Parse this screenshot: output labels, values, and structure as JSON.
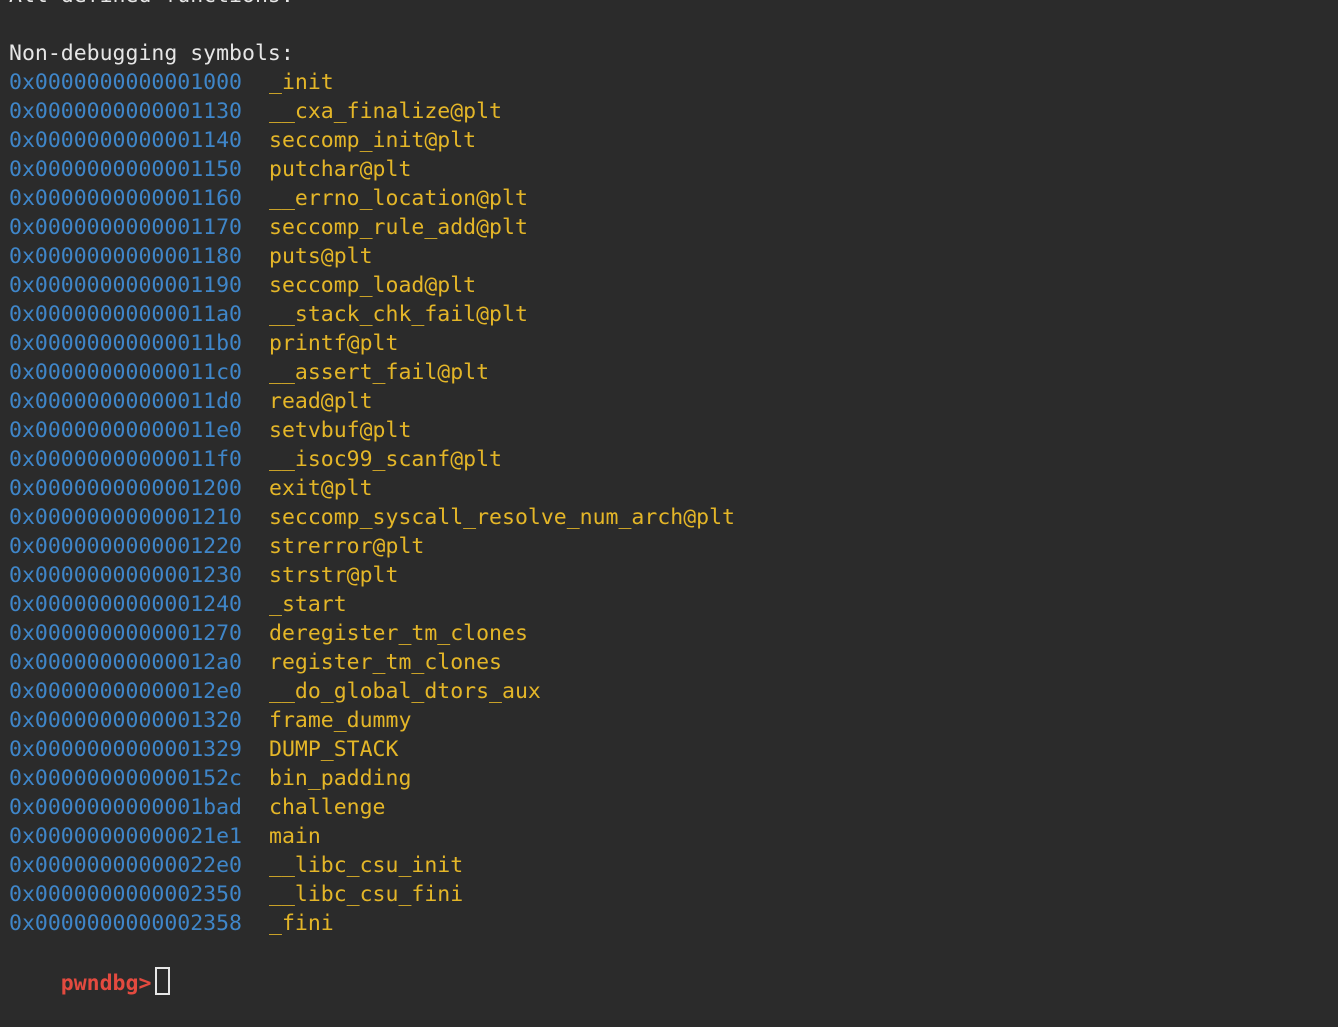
{
  "header": {
    "partial_line": "All defined functions:",
    "section_title": "Non-debugging symbols:"
  },
  "symbols": [
    {
      "addr": "0x0000000000001000",
      "name": "_init"
    },
    {
      "addr": "0x0000000000001130",
      "name": "__cxa_finalize@plt"
    },
    {
      "addr": "0x0000000000001140",
      "name": "seccomp_init@plt"
    },
    {
      "addr": "0x0000000000001150",
      "name": "putchar@plt"
    },
    {
      "addr": "0x0000000000001160",
      "name": "__errno_location@plt"
    },
    {
      "addr": "0x0000000000001170",
      "name": "seccomp_rule_add@plt"
    },
    {
      "addr": "0x0000000000001180",
      "name": "puts@plt"
    },
    {
      "addr": "0x0000000000001190",
      "name": "seccomp_load@plt"
    },
    {
      "addr": "0x00000000000011a0",
      "name": "__stack_chk_fail@plt"
    },
    {
      "addr": "0x00000000000011b0",
      "name": "printf@plt"
    },
    {
      "addr": "0x00000000000011c0",
      "name": "__assert_fail@plt"
    },
    {
      "addr": "0x00000000000011d0",
      "name": "read@plt"
    },
    {
      "addr": "0x00000000000011e0",
      "name": "setvbuf@plt"
    },
    {
      "addr": "0x00000000000011f0",
      "name": "__isoc99_scanf@plt"
    },
    {
      "addr": "0x0000000000001200",
      "name": "exit@plt"
    },
    {
      "addr": "0x0000000000001210",
      "name": "seccomp_syscall_resolve_num_arch@plt"
    },
    {
      "addr": "0x0000000000001220",
      "name": "strerror@plt"
    },
    {
      "addr": "0x0000000000001230",
      "name": "strstr@plt"
    },
    {
      "addr": "0x0000000000001240",
      "name": "_start"
    },
    {
      "addr": "0x0000000000001270",
      "name": "deregister_tm_clones"
    },
    {
      "addr": "0x00000000000012a0",
      "name": "register_tm_clones"
    },
    {
      "addr": "0x00000000000012e0",
      "name": "__do_global_dtors_aux"
    },
    {
      "addr": "0x0000000000001320",
      "name": "frame_dummy"
    },
    {
      "addr": "0x0000000000001329",
      "name": "DUMP_STACK"
    },
    {
      "addr": "0x000000000000152c",
      "name": "bin_padding"
    },
    {
      "addr": "0x0000000000001bad",
      "name": "challenge"
    },
    {
      "addr": "0x00000000000021e1",
      "name": "main"
    },
    {
      "addr": "0x00000000000022e0",
      "name": "__libc_csu_init"
    },
    {
      "addr": "0x0000000000002350",
      "name": "__libc_csu_fini"
    },
    {
      "addr": "0x0000000000002358",
      "name": "_fini"
    }
  ],
  "prompt": {
    "label": "pwndbg>",
    "input_value": ""
  },
  "colors": {
    "background": "#2b2b2b",
    "address": "#3f86c9",
    "symbol": "#e4b628",
    "prompt": "#e34a3f",
    "text": "#e6e6e6"
  }
}
